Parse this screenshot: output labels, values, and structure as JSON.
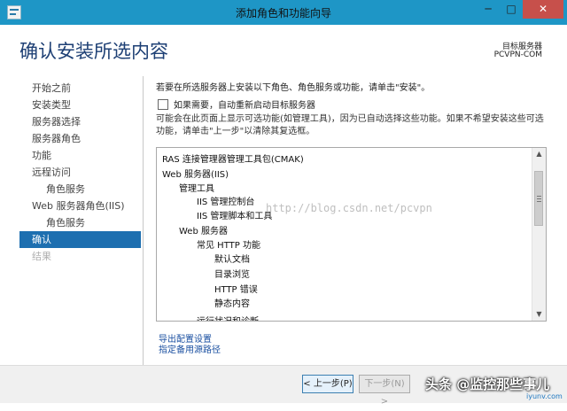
{
  "window": {
    "title": "添加角色和功能向导",
    "min_label": "─",
    "max_label": "□",
    "close_label": "✕"
  },
  "header": {
    "title": "确认安装所选内容",
    "target_label": "目标服务器",
    "target_name": "PCVPN-COM"
  },
  "nav": {
    "items": [
      {
        "label": "开始之前"
      },
      {
        "label": "安装类型"
      },
      {
        "label": "服务器选择"
      },
      {
        "label": "服务器角色"
      },
      {
        "label": "功能"
      },
      {
        "label": "远程访问"
      },
      {
        "label": "角色服务"
      },
      {
        "label": "Web 服务器角色(IIS)"
      },
      {
        "label": "角色服务"
      },
      {
        "label": "确认"
      },
      {
        "label": "结果"
      }
    ]
  },
  "content": {
    "intro": "若要在所选服务器上安装以下角色、角色服务或功能，请单击\"安装\"。",
    "restart_checkbox": {
      "label": "如果需要，自动重新启动目标服务器",
      "checked": false
    },
    "note": "可能会在此页面上显示可选功能(如管理工具)，因为已自动选择这些功能。如果不希望安装这些可选功能，请单击\"上一步\"以清除其复选框。",
    "items": [
      {
        "label": "RAS 连接管理器管理工具包(CMAK)"
      },
      {
        "label": "Web 服务器(IIS)"
      },
      {
        "label": "管理工具"
      },
      {
        "label": "IIS 管理控制台"
      },
      {
        "label": "IIS 管理脚本和工具"
      },
      {
        "label": "Web 服务器"
      },
      {
        "label": "常见 HTTP 功能"
      },
      {
        "label": "默认文档"
      },
      {
        "label": "目录浏览"
      },
      {
        "label": "HTTP 错误"
      },
      {
        "label": "静态内容"
      },
      {
        "label": "运行状况和诊断"
      }
    ],
    "scroll_up": "▲",
    "scroll_down": "▼"
  },
  "links": {
    "export": "导出配置设置",
    "alt_source": "指定备用源路径"
  },
  "footer": {
    "prev_label": "< 上一步(P)",
    "next_label": "下一步(N) >"
  },
  "watermarks": {
    "csdn": "http://blog.csdn.net/pcvpn",
    "main": "头条 @监控那些事儿",
    "site": "iyunv.com"
  }
}
